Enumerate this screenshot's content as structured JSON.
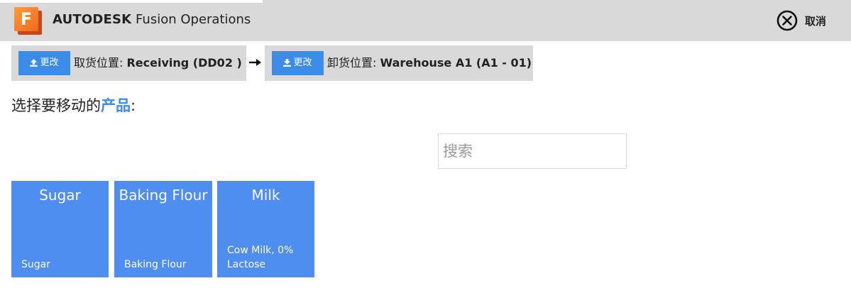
{
  "header": {
    "logo_letter": "F",
    "brand_bold": "AUTODESK",
    "brand_rest": " Fusion Operations",
    "cancel_label": "取消",
    "cancel_icon": "close-circle-icon"
  },
  "locations": {
    "pickup": {
      "button_label": "更改",
      "button_icon": "upload-icon",
      "label": "取货位置: ",
      "value": "Receiving (DD02 )"
    },
    "arrow_icon": "arrow-right-icon",
    "dropoff": {
      "button_label": "更改",
      "button_icon": "download-icon",
      "label": "卸货位置: ",
      "value": "Warehouse A1 (A1 - 01)"
    }
  },
  "prompt": {
    "prefix": "选择要移动的",
    "highlight": "产品",
    "suffix": ":"
  },
  "search": {
    "placeholder": "搜索",
    "value": ""
  },
  "products": [
    {
      "name": "Sugar",
      "description": "Sugar"
    },
    {
      "name": "Baking Flour",
      "description": "Baking Flour"
    },
    {
      "name": "Milk",
      "description": "Cow Milk, 0% Lactose"
    }
  ],
  "colors": {
    "accent": "#3b8ce8",
    "tile": "#4d8ef0",
    "header_bg": "#d9d9d9",
    "logo": "#f06a1e"
  }
}
